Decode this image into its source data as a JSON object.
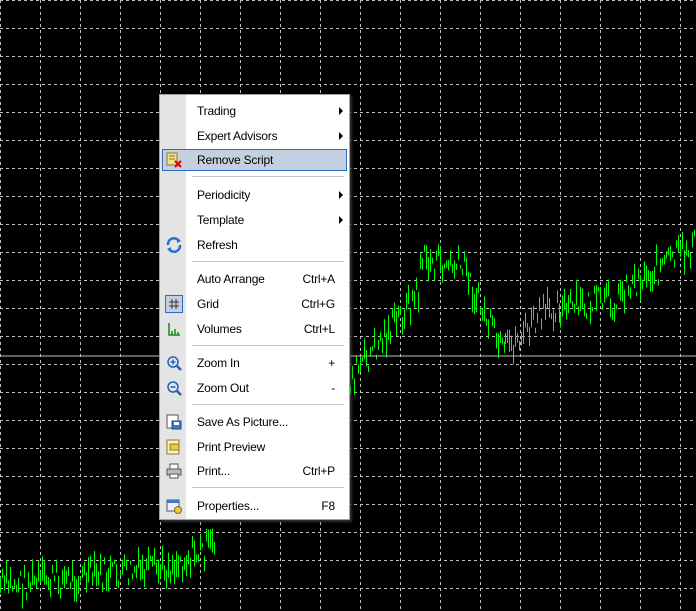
{
  "context_menu": {
    "items": [
      {
        "label": "Trading",
        "shortcut": "",
        "submenu": true,
        "icon": ""
      },
      {
        "label": "Expert Advisors",
        "shortcut": "",
        "submenu": true,
        "icon": ""
      },
      {
        "label": "Remove Script",
        "shortcut": "",
        "submenu": false,
        "icon": "remove-script-icon",
        "highlighted": true
      },
      {
        "label": "Periodicity",
        "shortcut": "",
        "submenu": true,
        "icon": ""
      },
      {
        "label": "Template",
        "shortcut": "",
        "submenu": true,
        "icon": ""
      },
      {
        "label": "Refresh",
        "shortcut": "",
        "submenu": false,
        "icon": "refresh-icon"
      },
      {
        "label": "Auto Arrange",
        "shortcut": "Ctrl+A",
        "submenu": false,
        "icon": ""
      },
      {
        "label": "Grid",
        "shortcut": "Ctrl+G",
        "submenu": false,
        "icon": "grid-icon",
        "checked": true
      },
      {
        "label": "Volumes",
        "shortcut": "Ctrl+L",
        "submenu": false,
        "icon": "volumes-icon"
      },
      {
        "label": "Zoom In",
        "shortcut": "+",
        "submenu": false,
        "icon": "zoom-in-icon"
      },
      {
        "label": "Zoom Out",
        "shortcut": "-",
        "submenu": false,
        "icon": "zoom-out-icon"
      },
      {
        "label": "Save As Picture...",
        "shortcut": "",
        "submenu": false,
        "icon": "save-picture-icon"
      },
      {
        "label": "Print Preview",
        "shortcut": "",
        "submenu": false,
        "icon": "print-preview-icon"
      },
      {
        "label": "Print...",
        "shortcut": "Ctrl+P",
        "submenu": false,
        "icon": "printer-icon"
      },
      {
        "label": "Properties...",
        "shortcut": "F8",
        "submenu": false,
        "icon": "properties-icon"
      }
    ]
  },
  "chart": {
    "background": "#000000",
    "grid_color": "#c0c0c0",
    "bar_color": "#00ff00"
  }
}
